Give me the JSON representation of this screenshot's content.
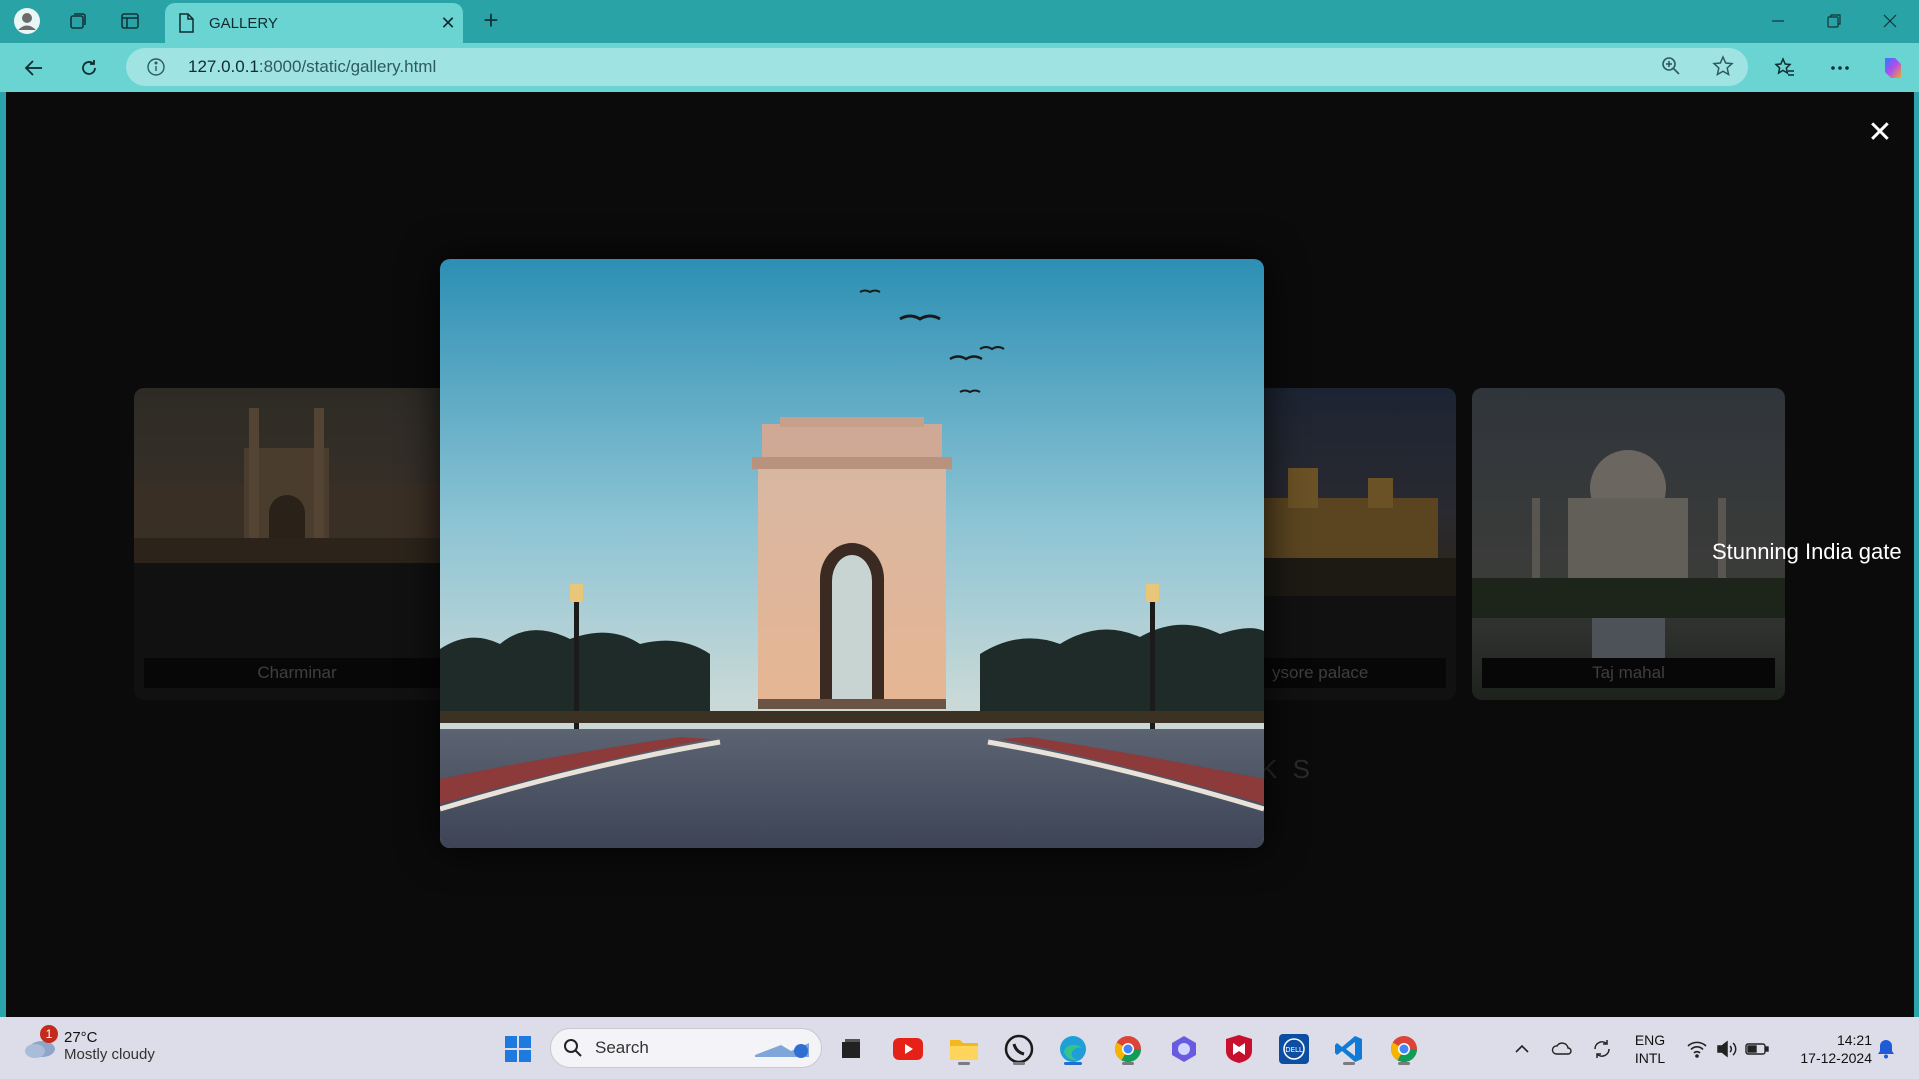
{
  "browser": {
    "tab_title": "GALLERY",
    "url_host": "127.0.0.1",
    "url_rest": ":8000/static/gallery.html"
  },
  "gallery": {
    "cards": [
      {
        "caption": "Charminar"
      },
      {
        "caption": "ysore palace"
      },
      {
        "caption": "Taj mahal"
      }
    ],
    "behind_heading_fragment": "K S"
  },
  "lightbox": {
    "caption": "Stunning India gate",
    "close_symbol": "✕"
  },
  "taskbar": {
    "weather_temp": "27°C",
    "weather_condition": "Mostly cloudy",
    "weather_badge": "1",
    "search_label": "Search",
    "lang_top": "ENG",
    "lang_bottom": "INTL",
    "time": "14:21",
    "date": "17-12-2024"
  }
}
